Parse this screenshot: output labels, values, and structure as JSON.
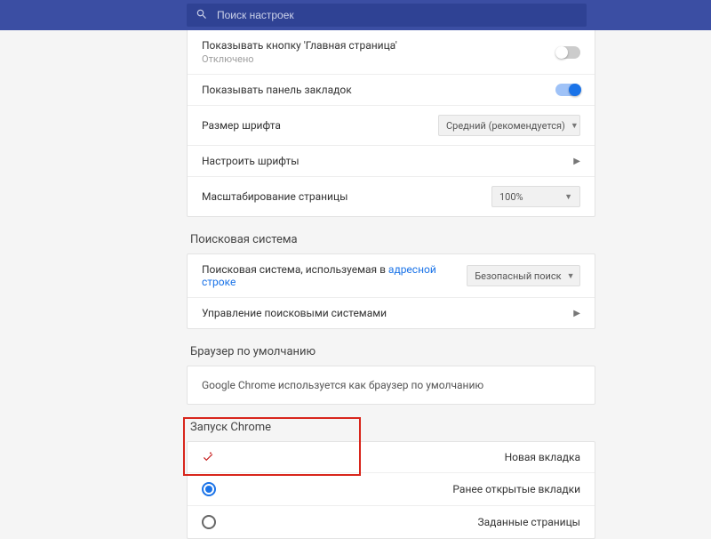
{
  "search": {
    "placeholder": "Поиск настроек"
  },
  "appearance": {
    "home_button": {
      "title": "Показывать кнопку 'Главная страница'",
      "status": "Отключено",
      "enabled": false
    },
    "bookmarks_bar": {
      "title": "Показывать панель закладок",
      "enabled": true
    },
    "font_size": {
      "title": "Размер шрифта",
      "value": "Средний (рекомендуется)"
    },
    "customize_fonts": {
      "title": "Настроить шрифты"
    },
    "page_zoom": {
      "title": "Масштабирование страницы",
      "value": "100%"
    }
  },
  "search_engine": {
    "section": "Поисковая система",
    "used": {
      "title": "Поисковая система, используемая в ",
      "link": "адресной строке",
      "value": "Безопасный поиск"
    },
    "manage": {
      "title": "Управление поисковыми системами"
    }
  },
  "default_browser": {
    "section": "Браузер по умолчанию",
    "text": "Google Chrome используется как браузер по умолчанию"
  },
  "startup": {
    "section": "Запуск Chrome",
    "new_tab": "Новая вкладка",
    "continue": "Ранее открытые вкладки",
    "specific": "Заданные страницы",
    "selected": "continue"
  }
}
